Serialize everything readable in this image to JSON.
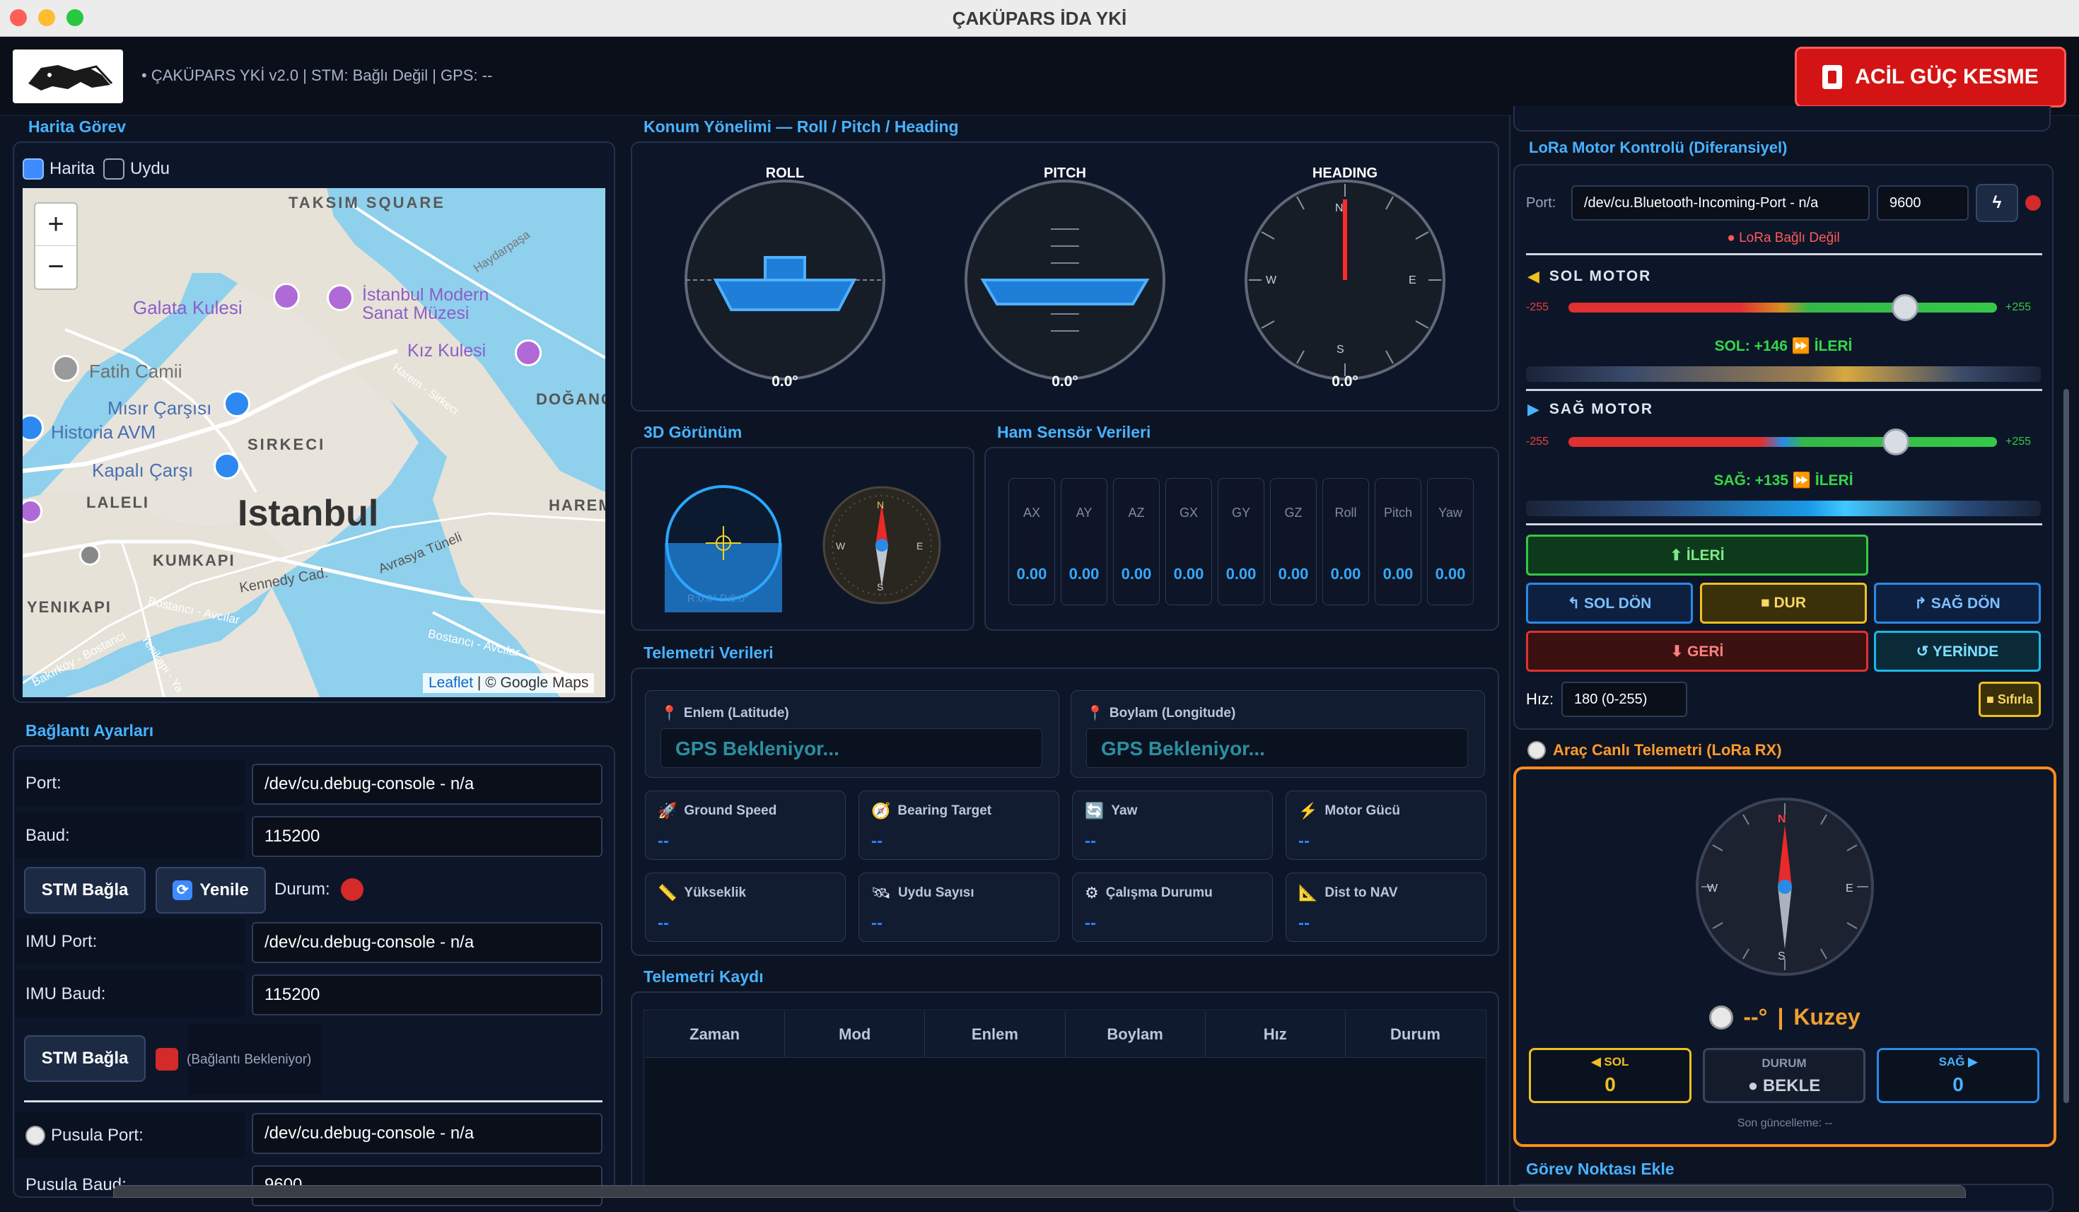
{
  "window": {
    "title": "ÇAKÜPARS İDA YKİ"
  },
  "topbar": {
    "status_line": "•  ÇAKÜPARS YKİ v2.0  |  STM: Bağlı Değil  |  GPS: --",
    "emergency_label": "ACİL GÜÇ KESME"
  },
  "map": {
    "section_title": "Harita  Görev",
    "opt_map": "Harita",
    "opt_sat": "Uydu",
    "zoom_in": "+",
    "zoom_out": "−",
    "attribution_link": "Leaflet",
    "attribution_rest": " | © Google Maps",
    "labels": {
      "taksim": "TAKSIM SQUARE",
      "galata": "Galata Kulesi",
      "istmodern": "İstanbul Modern",
      "sanat": "Sanat Müzesi",
      "fatih": "Fatih Camii",
      "misir": "Mısır Çarşısı",
      "historia": "Historia AVM",
      "kiz": "Kız Kulesi",
      "dogan": "DOĞANC",
      "sirkeci": "SIRKECI",
      "kapali": "Kapalı Çarşı",
      "laleli": "LALELI",
      "istanbul": "Istanbul",
      "harem": "HAREM",
      "kumkapi": "KUMKAPI",
      "kennedy": "Kennedy Cad.",
      "avrasya": "Avrasya Tüneli",
      "yenikapi": "YENIKAPI",
      "bostanci": "Bostancı - Avcılar",
      "bostanci2": "Bostancı - Avcılar",
      "haydarpasa": "Haydarpaşa",
      "bakirkoy": "Bakırköy - Bostancı",
      "yenikapi2": "Yenikapı - Ya",
      "harem2": "Harem - Sirkeci"
    }
  },
  "connection": {
    "section_title": "Bağlantı Ayarları",
    "port_label": "Port:",
    "port_value": "/dev/cu.debug-console - n/a",
    "baud_label": "Baud:",
    "baud_value": "115200",
    "stm_connect": "STM Bağla",
    "refresh": "Yenile",
    "durum_label": "Durum:",
    "imu_port_label": "IMU Port:",
    "imu_port_value": "/dev/cu.debug-console - n/a",
    "imu_baud_label": "IMU Baud:",
    "imu_baud_value": "115200",
    "stm_connect2": "STM Bağla",
    "waiting": "(Bağlantı Bekleniyor)",
    "compass_port_label": "Pusula Port:",
    "compass_port_value": "/dev/cu.debug-console - n/a",
    "compass_baud_label": "Pusula Baud:",
    "compass_baud_value": "9600"
  },
  "orientation": {
    "section_title": "Konum Yönelimi — Roll / Pitch / Heading",
    "roll_label": "ROLL",
    "roll_value": "0.0°",
    "pitch_label": "PITCH",
    "pitch_value": "0.0°",
    "heading_label": "HEADING",
    "heading_value": "0.0°",
    "n": "N",
    "s": "S",
    "e": "E",
    "w": "W"
  },
  "view3d": {
    "section_title": "3D Görünüm",
    "readout": "R:0.0° P:0.0°",
    "n": "N",
    "s": "S",
    "e": "E",
    "w": "W"
  },
  "raw": {
    "section_title": "Ham Sensör Verileri",
    "sensors": [
      {
        "label": "AX",
        "value": "0.00"
      },
      {
        "label": "AY",
        "value": "0.00"
      },
      {
        "label": "AZ",
        "value": "0.00"
      },
      {
        "label": "GX",
        "value": "0.00"
      },
      {
        "label": "GY",
        "value": "0.00"
      },
      {
        "label": "GZ",
        "value": "0.00"
      },
      {
        "label": "Roll",
        "value": "0.00"
      },
      {
        "label": "Pitch",
        "value": "0.00"
      },
      {
        "label": "Yaw",
        "value": "0.00"
      }
    ]
  },
  "telemetry": {
    "section_title": "Telemetri Verileri",
    "lat_label": "Enlem (Latitude)",
    "lat_value": "GPS Bekleniyor...",
    "lon_label": "Boylam (Longitude)",
    "lon_value": "GPS Bekleniyor...",
    "cards": [
      {
        "label": "Ground Speed",
        "value": "--",
        "icon": "rocket-icon",
        "glyph": "🚀"
      },
      {
        "label": "Bearing Target",
        "value": "--",
        "icon": "compass-icon",
        "glyph": "🧭"
      },
      {
        "label": "Yaw",
        "value": "--",
        "icon": "rotate-icon",
        "glyph": "🔄"
      },
      {
        "label": "Motor Gücü",
        "value": "--",
        "icon": "bolt-icon",
        "glyph": "⚡"
      },
      {
        "label": "Yükseklik",
        "value": "--",
        "icon": "ruler-icon",
        "glyph": "📏"
      },
      {
        "label": "Uydu Sayısı",
        "value": "--",
        "icon": "satellite-icon",
        "glyph": "🛰"
      },
      {
        "label": "Çalışma Durumu",
        "value": "--",
        "icon": "gear-icon",
        "glyph": "⚙"
      },
      {
        "label": "Dist to NAV",
        "value": "--",
        "icon": "triangle-ruler-icon",
        "glyph": "📐"
      }
    ]
  },
  "log": {
    "section_title": "Telemetri Kaydı",
    "columns": [
      "Zaman",
      "Mod",
      "Enlem",
      "Boylam",
      "Hız",
      "Durum"
    ]
  },
  "lora": {
    "section_title": "LoRa Motor Kontrolü (Diferansiyel)",
    "port_label": "Port:",
    "port_value": "/dev/cu.Bluetooth-Incoming-Port - n/a",
    "baud_value": "9600",
    "status": "● LoRa Bağlı Değil",
    "left_title": "SOL MOTOR",
    "min": "-255",
    "max": "+255",
    "left_readout": "SOL: +146 ⏩ İLERİ",
    "left_level": 146,
    "right_title": "SAĞ MOTOR",
    "right_readout": "SAĞ: +135 ⏩ İLERİ",
    "right_level": 135,
    "forward": "⬆ İLERİ",
    "turn_left": "↰ SOL DÖN",
    "stop": "■ DUR",
    "turn_right": "↱ SAĞ DÖN",
    "back": "⬇ GERİ",
    "in_place": "↺ YERİNDE",
    "speed_label": "Hız:",
    "speed_value": "180  (0-255)",
    "reset": "■ Sıfırla"
  },
  "live": {
    "section_title": "Araç Canlı Telemetri (LoRa RX)",
    "heading_value": "--°",
    "sep": "|",
    "direction": "Kuzey",
    "left_label": "◀ SOL",
    "left_value": "0",
    "state_label": "DURUM",
    "state_value": "● BEKLE",
    "right_label": "SAĞ ▶",
    "right_value": "0",
    "last_update": "Son güncelleme: --",
    "n": "N",
    "s": "S",
    "e": "E",
    "w": "W"
  },
  "waypoint": {
    "section_title": "Görev Noktası Ekle"
  },
  "colors": {
    "accent": "#48b2ff",
    "danger": "#d41414",
    "green": "#39c54a",
    "orange": "#ff8c1a",
    "yellow": "#f0c020"
  }
}
